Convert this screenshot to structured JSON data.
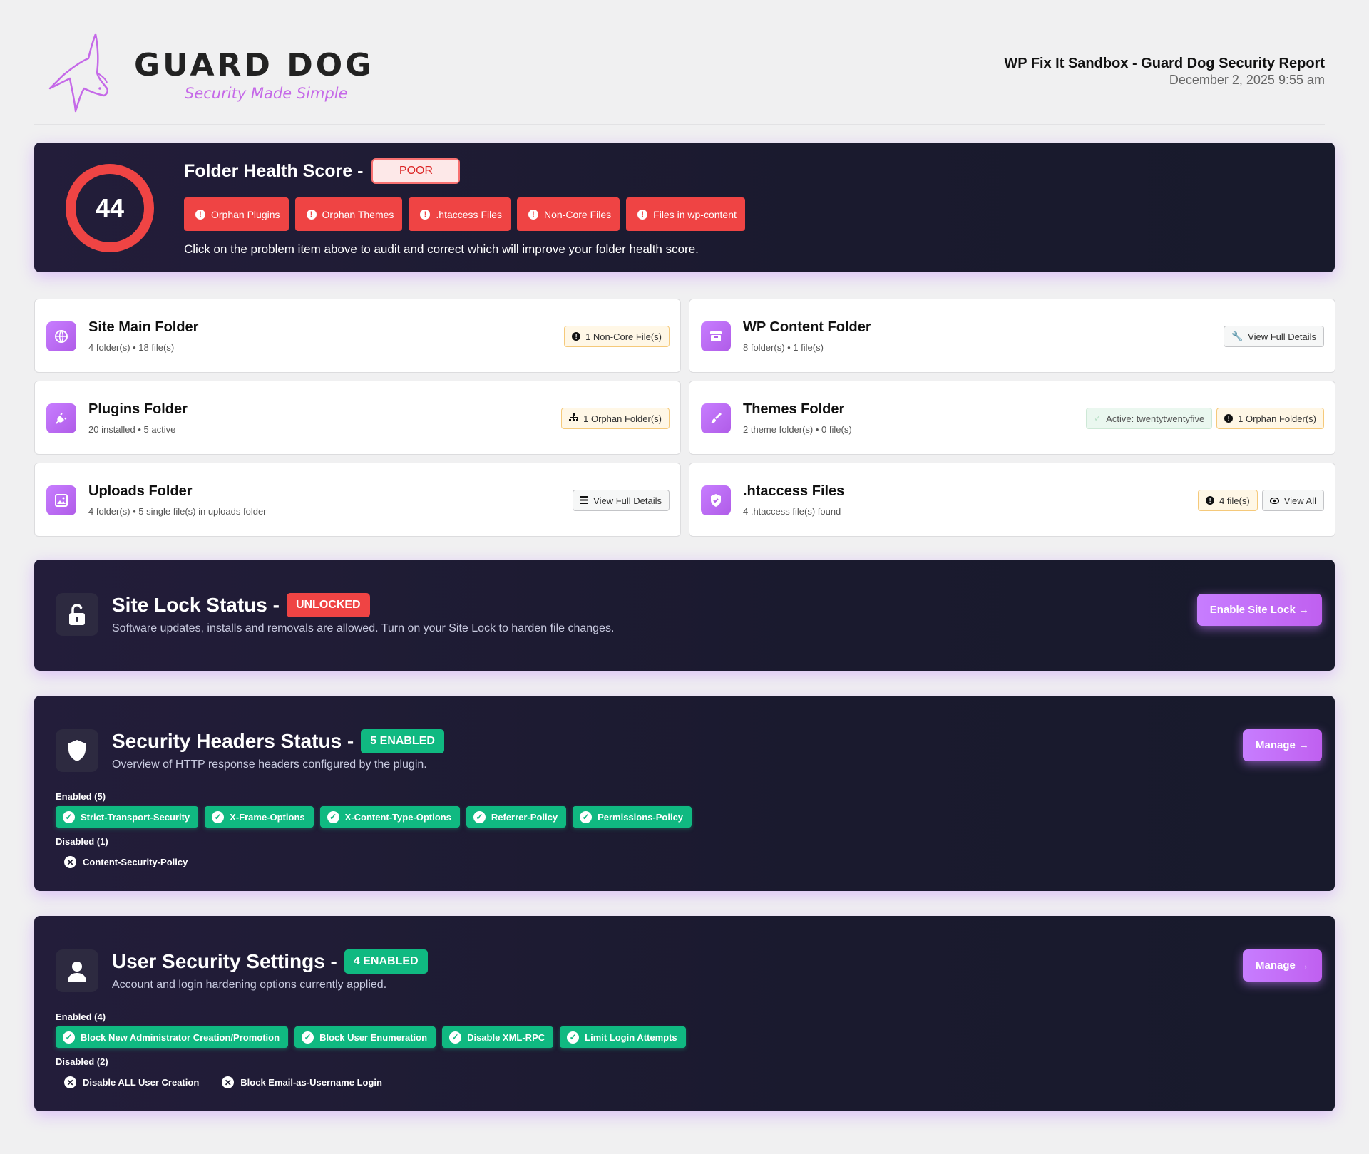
{
  "brand": {
    "name": "GUARD DOG",
    "tagline": "Security Made Simple",
    "accent": "#c569e8"
  },
  "report": {
    "title": "WP Fix It Sandbox - Guard Dog Security Report",
    "date": "December 2, 2025 9:55 am"
  },
  "health": {
    "score": "44",
    "title": "Folder Health Score -",
    "rating": "POOR",
    "problems": [
      "Orphan Plugins",
      "Orphan Themes",
      ".htaccess Files",
      "Non-Core Files",
      "Files in wp-content"
    ],
    "note": "Click on the problem item above to audit and correct which will improve your folder health score.",
    "color": "#ef4444"
  },
  "folders": {
    "site_main": {
      "title": "Site Main Folder",
      "sub": "4 folder(s) • 18 file(s)",
      "badge": "1 Non-Core File(s)"
    },
    "wp_content": {
      "title": "WP Content Folder",
      "sub": "8 folder(s) • 1 file(s)",
      "badge": "View Full Details"
    },
    "plugins": {
      "title": "Plugins Folder",
      "sub": "20 installed • 5 active",
      "badge": "1 Orphan Folder(s)"
    },
    "themes": {
      "title": "Themes Folder",
      "sub": "2 theme folder(s) • 0 file(s)",
      "badge_active": "Active: twentytwentyfive",
      "badge": "1 Orphan Folder(s)"
    },
    "uploads": {
      "title": "Uploads Folder",
      "sub": "4 folder(s) • 5 single file(s) in uploads folder",
      "badge": "View Full Details"
    },
    "htaccess": {
      "title": ".htaccess Files",
      "sub": "4 .htaccess file(s) found",
      "badge": "4 file(s)",
      "badge2": "View All"
    }
  },
  "site_lock": {
    "title": "Site Lock Status -",
    "status": "UNLOCKED",
    "sub": "Software updates, installs and removals are allowed. Turn on your Site Lock to harden file changes.",
    "cta": "Enable Site Lock →"
  },
  "headers": {
    "title": "Security Headers Status -",
    "status": "5 ENABLED",
    "sub": "Overview of HTTP response headers configured by the plugin.",
    "cta": "Manage →",
    "enabled_label": "Enabled (5)",
    "enabled": [
      "Strict-Transport-Security",
      "X-Frame-Options",
      "X-Content-Type-Options",
      "Referrer-Policy",
      "Permissions-Policy"
    ],
    "disabled_label": "Disabled (1)",
    "disabled": [
      "Content-Security-Policy"
    ]
  },
  "users": {
    "title": "User Security Settings -",
    "status": "4 ENABLED",
    "sub": "Account and login hardening options currently applied.",
    "cta": "Manage →",
    "enabled_label": "Enabled (4)",
    "enabled": [
      "Block New Administrator Creation/Promotion",
      "Block User Enumeration",
      "Disable XML-RPC",
      "Limit Login Attempts"
    ],
    "disabled_label": "Disabled (2)",
    "disabled": [
      "Disable ALL User Creation",
      "Block Email-as-Username Login"
    ]
  }
}
